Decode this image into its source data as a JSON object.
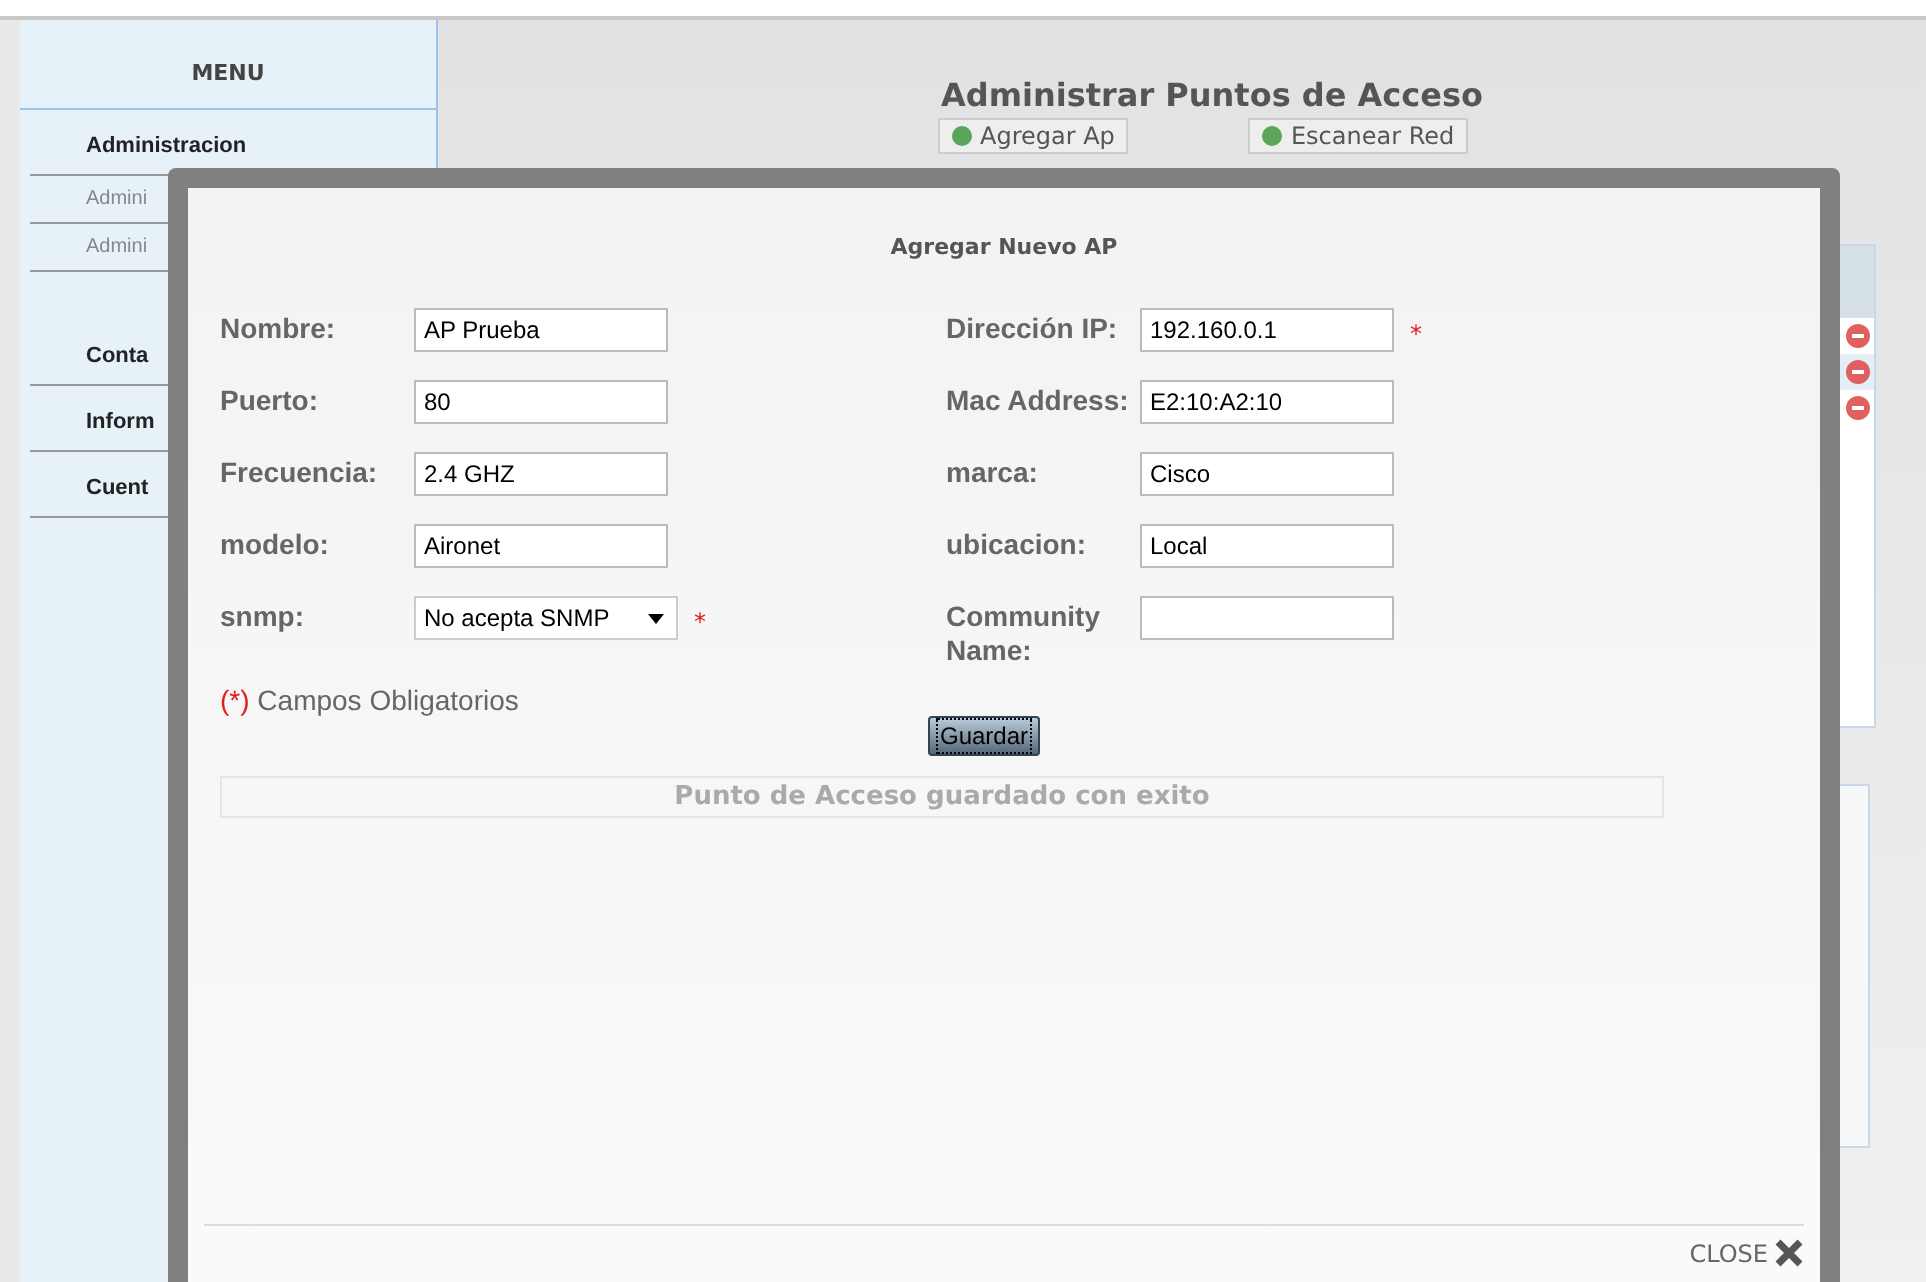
{
  "sidebar": {
    "title": "MENU",
    "items": [
      {
        "label": "Administracion",
        "kind": "section"
      },
      {
        "label": "Admini",
        "kind": "sub"
      },
      {
        "label": "Admini",
        "kind": "sub"
      },
      {
        "label": "Conta",
        "kind": "section"
      },
      {
        "label": "Inform",
        "kind": "section"
      },
      {
        "label": "Cuent",
        "kind": "section"
      }
    ]
  },
  "page": {
    "title": "Administrar Puntos de Acceso",
    "toolbar": [
      "Agregar Ap",
      "Escanear Red"
    ]
  },
  "dialog": {
    "title": "Agregar Nuevo AP",
    "required_mark": "*",
    "fields": [
      {
        "label": "Nombre:",
        "value": "AP Prueba",
        "kind": "text",
        "required": false
      },
      {
        "label": "Dirección IP:",
        "value": "192.160.0.1",
        "kind": "text",
        "required": true
      },
      {
        "label": "Puerto:",
        "value": "80",
        "kind": "text",
        "required": false
      },
      {
        "label": "Mac Address:",
        "value": "E2:10:A2:10",
        "kind": "text",
        "required": false
      },
      {
        "label": "Frecuencia:",
        "value": "2.4 GHZ",
        "kind": "text",
        "required": false
      },
      {
        "label": "marca:",
        "value": "Cisco",
        "kind": "text",
        "required": false
      },
      {
        "label": "modelo:",
        "value": "Aironet",
        "kind": "text",
        "required": false
      },
      {
        "label": "ubicacion:",
        "value": "Local",
        "kind": "text",
        "required": false
      },
      {
        "label": "snmp:",
        "value": "No acepta SNMP",
        "kind": "select",
        "required": true
      },
      {
        "label": "Community Name:",
        "kind": "text",
        "required": false
      }
    ],
    "required_note": {
      "mark": "(*)",
      "text": "Campos Obligatorios"
    },
    "save_button": "Guardar",
    "message": "Punto de Acceso guardado con exito",
    "close": "CLOSE"
  }
}
